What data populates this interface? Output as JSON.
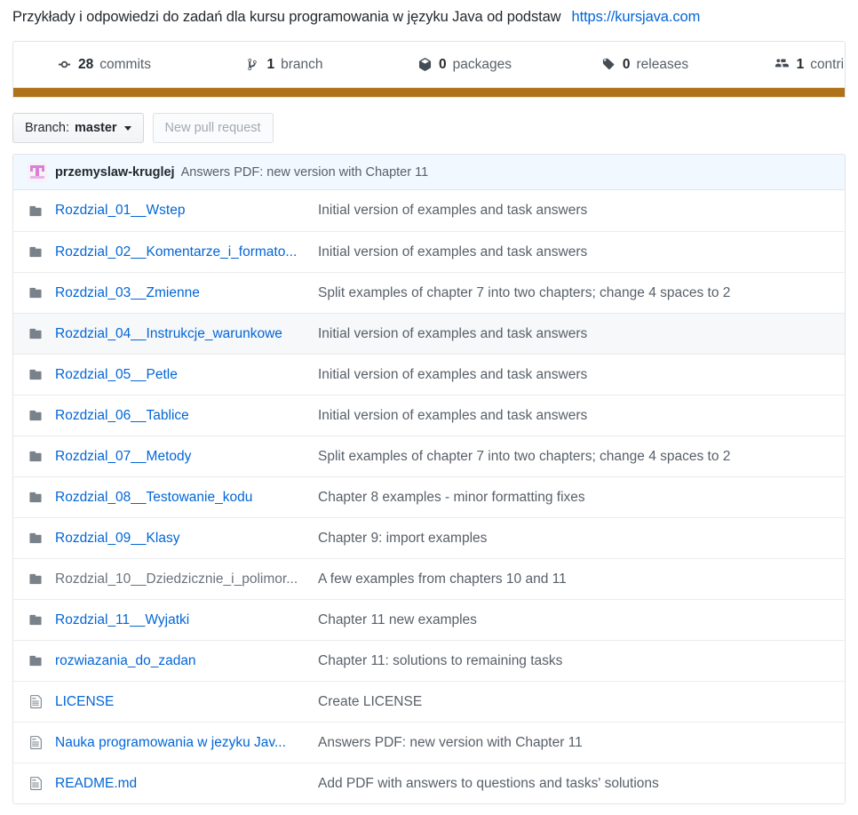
{
  "repo": {
    "description": "Przykłady i odpowiedzi do zadań dla kursu programowania w języku Java od podstaw",
    "homepage_url": "https://kursjava.com"
  },
  "numbers_summary": [
    {
      "icon": "commit-icon",
      "value": "28",
      "label": "commits"
    },
    {
      "icon": "branch-icon",
      "value": "1",
      "label": "branch"
    },
    {
      "icon": "package-icon",
      "value": "0",
      "label": "packages"
    },
    {
      "icon": "tag-icon",
      "value": "0",
      "label": "releases"
    },
    {
      "icon": "contributors-icon",
      "value": "1",
      "label": "contributor"
    }
  ],
  "language_bar": [
    {
      "name": "Java",
      "color": "#b07219",
      "percent": 100
    }
  ],
  "toolbar": {
    "branch_prefix": "Branch:",
    "branch_name": "master",
    "new_pull_request_label": "New pull request"
  },
  "latest_commit": {
    "author": "przemyslaw-kruglej",
    "message": "Answers PDF: new version with Chapter 11"
  },
  "files": [
    {
      "type": "folder",
      "name": "Rozdzial_01__Wstep",
      "muted": false,
      "commit": "Initial version of examples and task answers"
    },
    {
      "type": "folder",
      "name": "Rozdzial_02__Komentarze_i_formato...",
      "muted": false,
      "commit": "Initial version of examples and task answers"
    },
    {
      "type": "folder",
      "name": "Rozdzial_03__Zmienne",
      "muted": false,
      "commit": "Split examples of chapter 7 into two chapters; change 4 spaces to 2"
    },
    {
      "type": "folder",
      "name": "Rozdzial_04__Instrukcje_warunkowe",
      "muted": false,
      "commit": "Initial version of examples and task answers",
      "hovered": true
    },
    {
      "type": "folder",
      "name": "Rozdzial_05__Petle",
      "muted": false,
      "commit": "Initial version of examples and task answers"
    },
    {
      "type": "folder",
      "name": "Rozdzial_06__Tablice",
      "muted": false,
      "commit": "Initial version of examples and task answers"
    },
    {
      "type": "folder",
      "name": "Rozdzial_07__Metody",
      "muted": false,
      "commit": "Split examples of chapter 7 into two chapters; change 4 spaces to 2"
    },
    {
      "type": "folder",
      "name": "Rozdzial_08__Testowanie_kodu",
      "muted": false,
      "commit": "Chapter 8 examples - minor formatting fixes"
    },
    {
      "type": "folder",
      "name": "Rozdzial_09__Klasy",
      "muted": false,
      "commit": "Chapter 9: import examples"
    },
    {
      "type": "folder",
      "name": "Rozdzial_10__Dziedzicznie_i_polimor...",
      "muted": true,
      "commit": "A few examples from chapters 10 and 11"
    },
    {
      "type": "folder",
      "name": "Rozdzial_11__Wyjatki",
      "muted": false,
      "commit": "Chapter 11 new examples"
    },
    {
      "type": "folder",
      "name": "rozwiazania_do_zadan",
      "muted": false,
      "commit": "Chapter 11: solutions to remaining tasks"
    },
    {
      "type": "file",
      "name": "LICENSE",
      "muted": false,
      "commit": "Create LICENSE"
    },
    {
      "type": "file",
      "name": "Nauka programowania w jezyku Jav...",
      "muted": false,
      "commit": "Answers PDF: new version with Chapter 11"
    },
    {
      "type": "file",
      "name": "README.md",
      "muted": false,
      "commit": "Add PDF with answers to questions and tasks' solutions"
    }
  ]
}
